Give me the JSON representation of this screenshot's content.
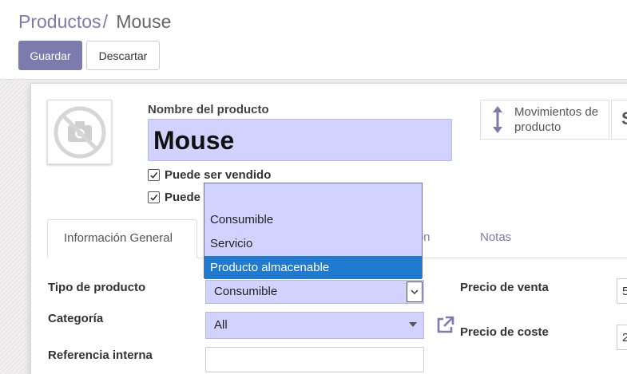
{
  "breadcrumb": {
    "parent": "Productos",
    "separator": "/",
    "current": "Mouse"
  },
  "actions": {
    "save_label": "Guardar",
    "discard_label": "Descartar"
  },
  "form": {
    "name_label": "Nombre del producto",
    "name_value": "Mouse",
    "checkbox_sale": {
      "label": "Puede ser vendido",
      "checked": true
    },
    "checkbox_purchase": {
      "label": "Puede",
      "checked": true
    },
    "stat_button": {
      "line1": "Movimientos de",
      "line2": "producto",
      "icon": "up-down-arrows-icon"
    },
    "stat_partial": "S"
  },
  "tabs": [
    {
      "label": "Información General",
      "active": true
    },
    {
      "label": "ción",
      "active": false
    },
    {
      "label": "Notas",
      "active": false
    }
  ],
  "fields": {
    "product_type": {
      "label": "Tipo de producto",
      "value": "Consumible"
    },
    "category": {
      "label": "Categoría",
      "value": "All"
    },
    "internal_ref": {
      "label": "Referencia interna",
      "value": ""
    },
    "sale_price": {
      "label": "Precio de venta",
      "value": "5"
    },
    "cost_price": {
      "label": "Precio de coste",
      "value": "2"
    }
  },
  "dropdown": {
    "options": [
      "",
      "Consumible",
      "Servicio",
      "Producto almacenable"
    ],
    "highlighted": "Producto almacenable"
  },
  "colors": {
    "brand": "#7c7bad",
    "field_required": "#d2d2ff",
    "option_highlight": "#1f7ad0"
  }
}
